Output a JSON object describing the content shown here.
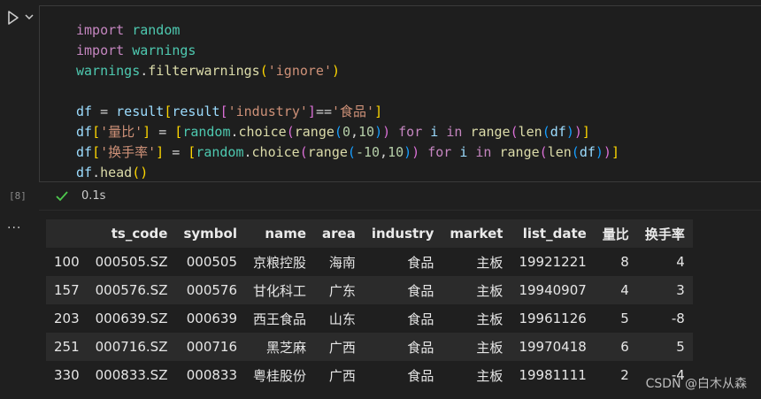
{
  "cell": {
    "execution_count": "[8]",
    "exec_time": "0.1s",
    "status": "success",
    "colors": {
      "success": "#4ec94e",
      "keyword": "#c586c0",
      "string": "#ce9178",
      "function": "#dcdcaa"
    },
    "icons": {
      "run": "run-triangle-icon",
      "expand": "chevron-down-icon",
      "status": "checkmark-icon",
      "output_menu": "ellipsis-icon"
    }
  },
  "code": [
    [
      {
        "t": "import",
        "c": "kw"
      },
      {
        "t": " "
      },
      {
        "t": "random",
        "c": "mod"
      }
    ],
    [
      {
        "t": "import",
        "c": "kw"
      },
      {
        "t": " "
      },
      {
        "t": "warnings",
        "c": "mod"
      }
    ],
    [
      {
        "t": "warnings",
        "c": "mod"
      },
      {
        "t": "."
      },
      {
        "t": "filterwarnings",
        "c": "fn"
      },
      {
        "t": "(",
        "c": "br1"
      },
      {
        "t": "'ignore'",
        "c": "str"
      },
      {
        "t": ")",
        "c": "br1"
      }
    ],
    [],
    [
      {
        "t": "df",
        "c": "var"
      },
      {
        "t": " = "
      },
      {
        "t": "result",
        "c": "var"
      },
      {
        "t": "[",
        "c": "br1"
      },
      {
        "t": "result",
        "c": "var"
      },
      {
        "t": "[",
        "c": "br2"
      },
      {
        "t": "'industry'",
        "c": "str"
      },
      {
        "t": "]",
        "c": "br2"
      },
      {
        "t": "=="
      },
      {
        "t": "'食品'",
        "c": "str"
      },
      {
        "t": "]",
        "c": "br1"
      }
    ],
    [
      {
        "t": "df",
        "c": "var"
      },
      {
        "t": "[",
        "c": "br1"
      },
      {
        "t": "'量比'",
        "c": "str"
      },
      {
        "t": "]",
        "c": "br1"
      },
      {
        "t": " = "
      },
      {
        "t": "[",
        "c": "br1"
      },
      {
        "t": "random",
        "c": "mod"
      },
      {
        "t": "."
      },
      {
        "t": "choice",
        "c": "fn"
      },
      {
        "t": "(",
        "c": "br2"
      },
      {
        "t": "range",
        "c": "fn"
      },
      {
        "t": "(",
        "c": "br3"
      },
      {
        "t": "0",
        "c": "num"
      },
      {
        "t": ","
      },
      {
        "t": "10",
        "c": "num"
      },
      {
        "t": ")",
        "c": "br3"
      },
      {
        "t": ")",
        "c": "br2"
      },
      {
        "t": " "
      },
      {
        "t": "for",
        "c": "kw"
      },
      {
        "t": " "
      },
      {
        "t": "i",
        "c": "var"
      },
      {
        "t": " "
      },
      {
        "t": "in",
        "c": "kw"
      },
      {
        "t": " "
      },
      {
        "t": "range",
        "c": "fn"
      },
      {
        "t": "(",
        "c": "br2"
      },
      {
        "t": "len",
        "c": "fn"
      },
      {
        "t": "(",
        "c": "br3"
      },
      {
        "t": "df",
        "c": "var"
      },
      {
        "t": ")",
        "c": "br3"
      },
      {
        "t": ")",
        "c": "br2"
      },
      {
        "t": "]",
        "c": "br1"
      }
    ],
    [
      {
        "t": "df",
        "c": "var"
      },
      {
        "t": "[",
        "c": "br1"
      },
      {
        "t": "'换手率'",
        "c": "str"
      },
      {
        "t": "]",
        "c": "br1"
      },
      {
        "t": " = "
      },
      {
        "t": "[",
        "c": "br1"
      },
      {
        "t": "random",
        "c": "mod"
      },
      {
        "t": "."
      },
      {
        "t": "choice",
        "c": "fn"
      },
      {
        "t": "(",
        "c": "br2"
      },
      {
        "t": "range",
        "c": "fn"
      },
      {
        "t": "(",
        "c": "br3"
      },
      {
        "t": "-10",
        "c": "num"
      },
      {
        "t": ","
      },
      {
        "t": "10",
        "c": "num"
      },
      {
        "t": ")",
        "c": "br3"
      },
      {
        "t": ")",
        "c": "br2"
      },
      {
        "t": " "
      },
      {
        "t": "for",
        "c": "kw"
      },
      {
        "t": " "
      },
      {
        "t": "i",
        "c": "var"
      },
      {
        "t": " "
      },
      {
        "t": "in",
        "c": "kw"
      },
      {
        "t": " "
      },
      {
        "t": "range",
        "c": "fn"
      },
      {
        "t": "(",
        "c": "br2"
      },
      {
        "t": "len",
        "c": "fn"
      },
      {
        "t": "(",
        "c": "br3"
      },
      {
        "t": "df",
        "c": "var"
      },
      {
        "t": ")",
        "c": "br3"
      },
      {
        "t": ")",
        "c": "br2"
      },
      {
        "t": "]",
        "c": "br1"
      }
    ],
    [
      {
        "t": "df",
        "c": "var"
      },
      {
        "t": "."
      },
      {
        "t": "head",
        "c": "fn"
      },
      {
        "t": "(",
        "c": "br1"
      },
      {
        "t": ")",
        "c": "br1"
      }
    ]
  ],
  "output": {
    "ellipsis": "...",
    "columns": [
      "",
      "ts_code",
      "symbol",
      "name",
      "area",
      "industry",
      "market",
      "list_date",
      "量比",
      "换手率"
    ],
    "rows": [
      [
        "100",
        "000505.SZ",
        "000505",
        "京粮控股",
        "海南",
        "食品",
        "主板",
        "19921221",
        "8",
        "4"
      ],
      [
        "157",
        "000576.SZ",
        "000576",
        "甘化科工",
        "广东",
        "食品",
        "主板",
        "19940907",
        "4",
        "3"
      ],
      [
        "203",
        "000639.SZ",
        "000639",
        "西王食品",
        "山东",
        "食品",
        "主板",
        "19961126",
        "5",
        "-8"
      ],
      [
        "251",
        "000716.SZ",
        "000716",
        "黑芝麻",
        "广西",
        "食品",
        "主板",
        "19970418",
        "6",
        "5"
      ],
      [
        "330",
        "000833.SZ",
        "000833",
        "粤桂股份",
        "广西",
        "食品",
        "主板",
        "19981111",
        "2",
        "-4"
      ]
    ]
  },
  "watermark": "CSDN @白木从森"
}
